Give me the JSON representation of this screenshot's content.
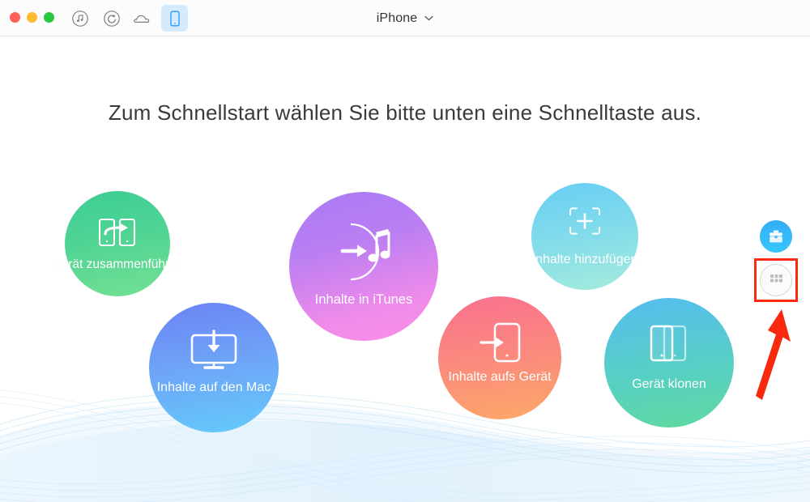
{
  "window": {
    "device_name": "iPhone",
    "traffic_lights": [
      "close",
      "minimize",
      "maximize"
    ],
    "toolbar_icons": [
      {
        "name": "music-icon",
        "label": "Musik",
        "active": false
      },
      {
        "name": "refresh-icon",
        "label": "Verlauf",
        "active": false
      },
      {
        "name": "cloud-icon",
        "label": "iCloud",
        "active": false
      },
      {
        "name": "device-icon",
        "label": "Gerät",
        "active": true
      }
    ]
  },
  "main": {
    "headline": "Zum Schnellstart wählen Sie bitte unten eine Schnelltaste aus.",
    "bubbles": [
      {
        "id": "merge-device",
        "label": "Gerät zusammenführen",
        "icon": "two-phones-arrow-icon",
        "color_top": "#3ccd95",
        "color_bottom": "#74e095"
      },
      {
        "id": "content-to-itunes",
        "label": "Inhalte in iTunes",
        "icon": "music-note-arrow-icon",
        "color_top": "#a479f5",
        "color_bottom": "#fa8fe8"
      },
      {
        "id": "add-content",
        "label": "Inhalte hinzufügen",
        "icon": "plus-target-icon",
        "color_top": "#69cff3",
        "color_bottom": "#9fe9dd"
      },
      {
        "id": "content-to-mac",
        "label": "Inhalte auf den Mac",
        "icon": "monitor-download-icon",
        "color_top": "#6a82f4",
        "color_bottom": "#62c9f8"
      },
      {
        "id": "content-to-device",
        "label": "Inhalte aufs Gerät",
        "icon": "phone-arrow-in-icon",
        "color_top": "#f9768f",
        "color_bottom": "#fba665"
      },
      {
        "id": "clone-device",
        "label": "Gerät klonen",
        "icon": "two-phones-icon",
        "color_top": "#56bdf0",
        "color_bottom": "#5fd99f"
      }
    ]
  },
  "side_buttons": {
    "toolbox": {
      "name": "toolbox-icon",
      "label": "Toolbox"
    },
    "grid": {
      "name": "grid-apps-icon",
      "label": "Apps"
    }
  },
  "annotation": {
    "highlight_color": "#fc2b10",
    "arrow_color": "#f8290c",
    "target": "grid-apps-button"
  }
}
